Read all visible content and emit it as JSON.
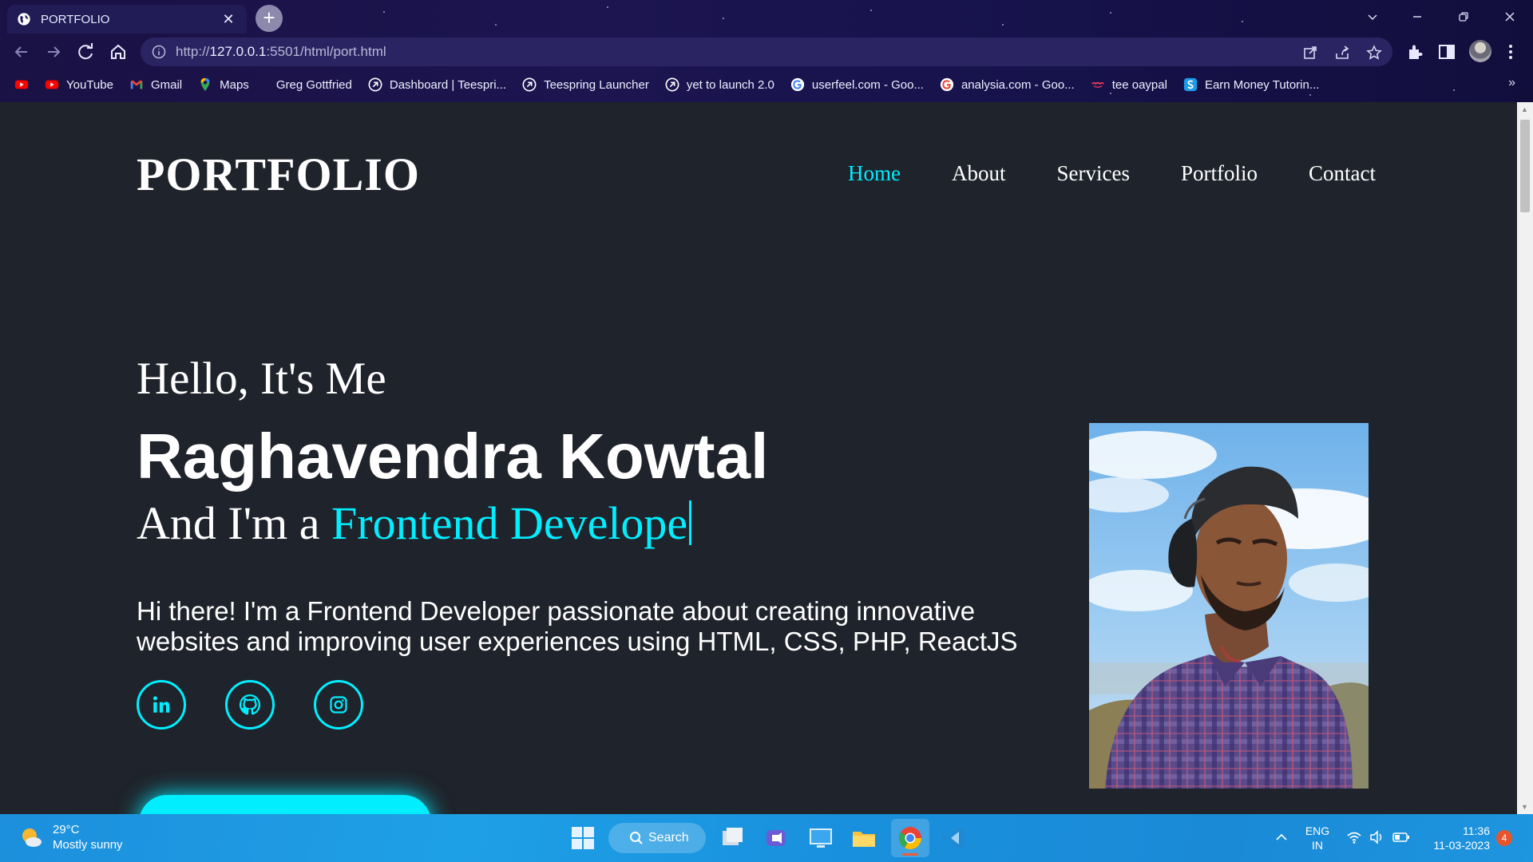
{
  "browser": {
    "tab_title": "PORTFOLIO",
    "url_prefix": "http://",
    "url_host": "127.0.0.1",
    "url_rest": ":5501/html/port.html",
    "bookmarks": [
      {
        "label": "",
        "icon": "youtube-icon"
      },
      {
        "label": "YouTube",
        "icon": "youtube-icon"
      },
      {
        "label": "Gmail",
        "icon": "gmail-icon"
      },
      {
        "label": "Maps",
        "icon": "maps-icon"
      },
      {
        "label": "Greg Gottfried",
        "icon": ""
      },
      {
        "label": "Dashboard | Teespri...",
        "icon": "teespring-icon"
      },
      {
        "label": "Teespring Launcher",
        "icon": "teespring-icon"
      },
      {
        "label": "yet to launch 2.0",
        "icon": "teespring-icon"
      },
      {
        "label": "userfeel.com - Goo...",
        "icon": "google-icon"
      },
      {
        "label": "analysia.com - Goo...",
        "icon": "google-icon"
      },
      {
        "label": "tee oaypal",
        "icon": "tee-icon"
      },
      {
        "label": "Earn Money Tutorin...",
        "icon": "skype-icon"
      }
    ],
    "more": "»"
  },
  "site": {
    "logo": "PORTFOLIO",
    "nav": [
      "Home",
      "About",
      "Services",
      "Portfolio",
      "Contact"
    ],
    "greeting": "Hello, It's Me",
    "name": "Raghavendra Kowtal",
    "role_prefix": "And I'm a ",
    "role_typed": "Frontend Develope",
    "intro": "Hi there! I'm a Frontend Developer passionate about creating innovative websites and improving user experiences using HTML, CSS, PHP, ReactJS",
    "accent": "#00eeff",
    "background": "#1f232b"
  },
  "taskbar": {
    "temp": "29°C",
    "weather": "Mostly sunny",
    "search": "Search",
    "lang1": "ENG",
    "lang2": "IN",
    "time": "11:36",
    "date": "11-03-2023",
    "notifications": "4"
  }
}
